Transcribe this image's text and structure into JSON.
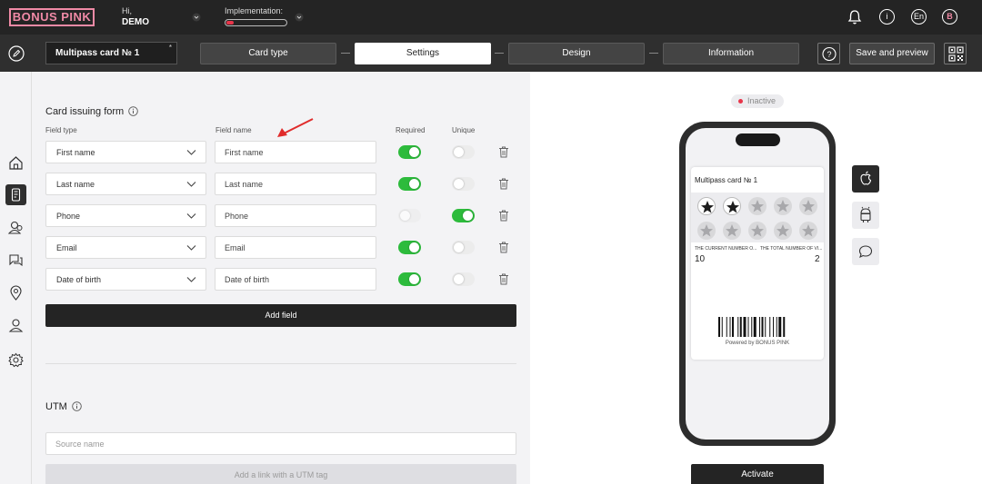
{
  "header": {
    "logo": "BONUS PINK",
    "greeting": "Hi,",
    "user": "DEMO",
    "implementation_label": "Implementation:",
    "implementation_progress": 0.12,
    "language": "En",
    "avatar_letter": "B"
  },
  "toolbar": {
    "card_name": "Multipass card № 1",
    "card_name_marker": "*",
    "steps": [
      {
        "label": "Card type",
        "active": false
      },
      {
        "label": "Settings",
        "active": true
      },
      {
        "label": "Design",
        "active": false
      },
      {
        "label": "Information",
        "active": false
      }
    ],
    "save_label": "Save and preview"
  },
  "form": {
    "title": "Card issuing form",
    "columns": {
      "field_type": "Field type",
      "field_name": "Field name",
      "required": "Required",
      "unique": "Unique"
    },
    "rows": [
      {
        "type": "First name",
        "name": "First name",
        "required": true,
        "unique": false,
        "required_disabled": false
      },
      {
        "type": "Last name",
        "name": "Last name",
        "required": true,
        "unique": false,
        "required_disabled": false
      },
      {
        "type": "Phone",
        "name": "Phone",
        "required": false,
        "unique": true,
        "required_disabled": true
      },
      {
        "type": "Email",
        "name": "Email",
        "required": true,
        "unique": false,
        "required_disabled": false
      },
      {
        "type": "Date of birth",
        "name": "Date of birth",
        "required": true,
        "unique": false,
        "required_disabled": false
      }
    ],
    "add_field_label": "Add field"
  },
  "utm": {
    "title": "UTM",
    "source_placeholder": "Source name",
    "add_link_label": "Add a link with a UTM tag"
  },
  "preview": {
    "status": "Inactive",
    "pass_title": "Multipass card № 1",
    "stamps_filled": 2,
    "stamps_total": 10,
    "stat1_label": "THE CURRENT NUMBER O...",
    "stat1_value": "10",
    "stat2_label": "THE TOTAL NUMBER OF VI...",
    "stat2_value": "2",
    "powered_by": "Powered by BONUS PINK",
    "activate_label": "Activate"
  },
  "colors": {
    "accent_pink": "#f08aa6",
    "toggle_on": "#2dbb3c",
    "status_red": "#e8354a",
    "dark": "#242424"
  }
}
